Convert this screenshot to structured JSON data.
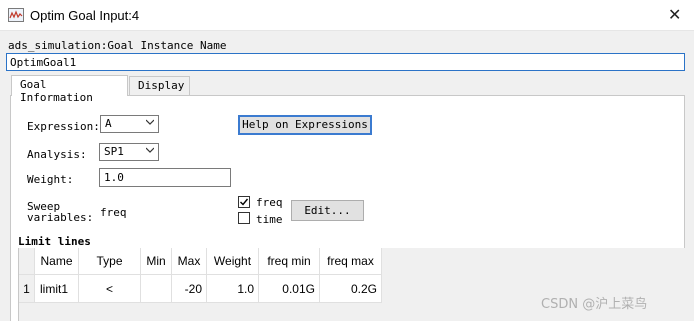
{
  "window": {
    "title": "Optim Goal Input:4",
    "close_symbol": "✕"
  },
  "instance": {
    "label": "ads_simulation:Goal Instance Name",
    "value": "OptimGoal1"
  },
  "tabs": [
    {
      "label": "Goal Information",
      "active": true
    },
    {
      "label": "Display",
      "active": false
    }
  ],
  "form": {
    "expression_label": "Expression:",
    "expression_value": "A",
    "help_button": "Help on Expressions",
    "analysis_label": "Analysis:",
    "analysis_value": "SP1",
    "weight_label": "Weight:",
    "weight_value": "1.0",
    "sweep_label_line1": "Sweep",
    "sweep_label_line2": "variables:",
    "sweep_value": "freq",
    "checkbox_freq": {
      "label": "freq",
      "checked": true
    },
    "checkbox_time": {
      "label": "time",
      "checked": false
    },
    "edit_button": "Edit..."
  },
  "limit_lines": {
    "title": "Limit lines",
    "columns": [
      "Name",
      "Type",
      "Min",
      "Max",
      "Weight",
      "freq min",
      "freq max"
    ],
    "rows": [
      {
        "index": "1",
        "cells": [
          "limit1",
          "<",
          "",
          "-20",
          "1.0",
          "0.01G",
          "0.2G"
        ]
      }
    ]
  },
  "watermark": "CSDN @沪上菜鸟"
}
